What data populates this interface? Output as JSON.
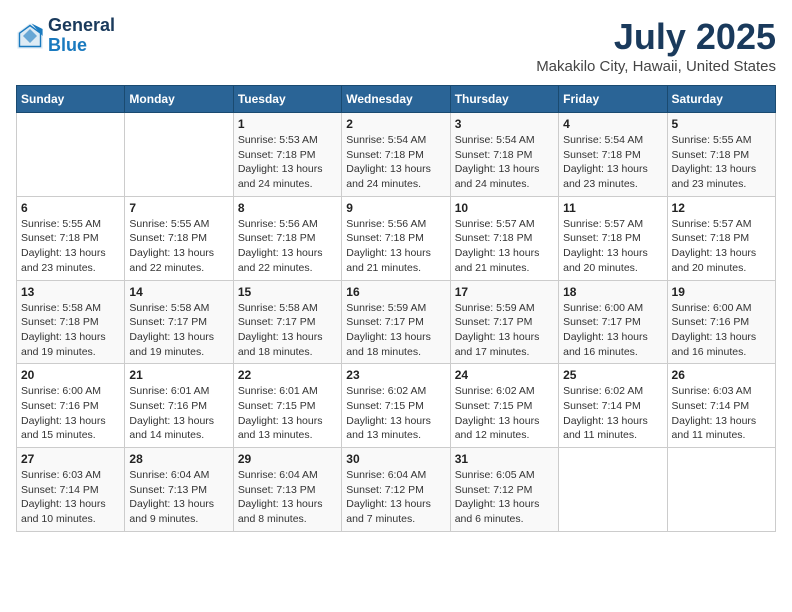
{
  "header": {
    "logo_line1": "General",
    "logo_line2": "Blue",
    "month": "July 2025",
    "location": "Makakilo City, Hawaii, United States"
  },
  "weekdays": [
    "Sunday",
    "Monday",
    "Tuesday",
    "Wednesday",
    "Thursday",
    "Friday",
    "Saturday"
  ],
  "weeks": [
    [
      {
        "day": "",
        "info": ""
      },
      {
        "day": "",
        "info": ""
      },
      {
        "day": "1",
        "info": "Sunrise: 5:53 AM\nSunset: 7:18 PM\nDaylight: 13 hours and 24 minutes."
      },
      {
        "day": "2",
        "info": "Sunrise: 5:54 AM\nSunset: 7:18 PM\nDaylight: 13 hours and 24 minutes."
      },
      {
        "day": "3",
        "info": "Sunrise: 5:54 AM\nSunset: 7:18 PM\nDaylight: 13 hours and 24 minutes."
      },
      {
        "day": "4",
        "info": "Sunrise: 5:54 AM\nSunset: 7:18 PM\nDaylight: 13 hours and 23 minutes."
      },
      {
        "day": "5",
        "info": "Sunrise: 5:55 AM\nSunset: 7:18 PM\nDaylight: 13 hours and 23 minutes."
      }
    ],
    [
      {
        "day": "6",
        "info": "Sunrise: 5:55 AM\nSunset: 7:18 PM\nDaylight: 13 hours and 23 minutes."
      },
      {
        "day": "7",
        "info": "Sunrise: 5:55 AM\nSunset: 7:18 PM\nDaylight: 13 hours and 22 minutes."
      },
      {
        "day": "8",
        "info": "Sunrise: 5:56 AM\nSunset: 7:18 PM\nDaylight: 13 hours and 22 minutes."
      },
      {
        "day": "9",
        "info": "Sunrise: 5:56 AM\nSunset: 7:18 PM\nDaylight: 13 hours and 21 minutes."
      },
      {
        "day": "10",
        "info": "Sunrise: 5:57 AM\nSunset: 7:18 PM\nDaylight: 13 hours and 21 minutes."
      },
      {
        "day": "11",
        "info": "Sunrise: 5:57 AM\nSunset: 7:18 PM\nDaylight: 13 hours and 20 minutes."
      },
      {
        "day": "12",
        "info": "Sunrise: 5:57 AM\nSunset: 7:18 PM\nDaylight: 13 hours and 20 minutes."
      }
    ],
    [
      {
        "day": "13",
        "info": "Sunrise: 5:58 AM\nSunset: 7:18 PM\nDaylight: 13 hours and 19 minutes."
      },
      {
        "day": "14",
        "info": "Sunrise: 5:58 AM\nSunset: 7:17 PM\nDaylight: 13 hours and 19 minutes."
      },
      {
        "day": "15",
        "info": "Sunrise: 5:58 AM\nSunset: 7:17 PM\nDaylight: 13 hours and 18 minutes."
      },
      {
        "day": "16",
        "info": "Sunrise: 5:59 AM\nSunset: 7:17 PM\nDaylight: 13 hours and 18 minutes."
      },
      {
        "day": "17",
        "info": "Sunrise: 5:59 AM\nSunset: 7:17 PM\nDaylight: 13 hours and 17 minutes."
      },
      {
        "day": "18",
        "info": "Sunrise: 6:00 AM\nSunset: 7:17 PM\nDaylight: 13 hours and 16 minutes."
      },
      {
        "day": "19",
        "info": "Sunrise: 6:00 AM\nSunset: 7:16 PM\nDaylight: 13 hours and 16 minutes."
      }
    ],
    [
      {
        "day": "20",
        "info": "Sunrise: 6:00 AM\nSunset: 7:16 PM\nDaylight: 13 hours and 15 minutes."
      },
      {
        "day": "21",
        "info": "Sunrise: 6:01 AM\nSunset: 7:16 PM\nDaylight: 13 hours and 14 minutes."
      },
      {
        "day": "22",
        "info": "Sunrise: 6:01 AM\nSunset: 7:15 PM\nDaylight: 13 hours and 13 minutes."
      },
      {
        "day": "23",
        "info": "Sunrise: 6:02 AM\nSunset: 7:15 PM\nDaylight: 13 hours and 13 minutes."
      },
      {
        "day": "24",
        "info": "Sunrise: 6:02 AM\nSunset: 7:15 PM\nDaylight: 13 hours and 12 minutes."
      },
      {
        "day": "25",
        "info": "Sunrise: 6:02 AM\nSunset: 7:14 PM\nDaylight: 13 hours and 11 minutes."
      },
      {
        "day": "26",
        "info": "Sunrise: 6:03 AM\nSunset: 7:14 PM\nDaylight: 13 hours and 11 minutes."
      }
    ],
    [
      {
        "day": "27",
        "info": "Sunrise: 6:03 AM\nSunset: 7:14 PM\nDaylight: 13 hours and 10 minutes."
      },
      {
        "day": "28",
        "info": "Sunrise: 6:04 AM\nSunset: 7:13 PM\nDaylight: 13 hours and 9 minutes."
      },
      {
        "day": "29",
        "info": "Sunrise: 6:04 AM\nSunset: 7:13 PM\nDaylight: 13 hours and 8 minutes."
      },
      {
        "day": "30",
        "info": "Sunrise: 6:04 AM\nSunset: 7:12 PM\nDaylight: 13 hours and 7 minutes."
      },
      {
        "day": "31",
        "info": "Sunrise: 6:05 AM\nSunset: 7:12 PM\nDaylight: 13 hours and 6 minutes."
      },
      {
        "day": "",
        "info": ""
      },
      {
        "day": "",
        "info": ""
      }
    ]
  ]
}
